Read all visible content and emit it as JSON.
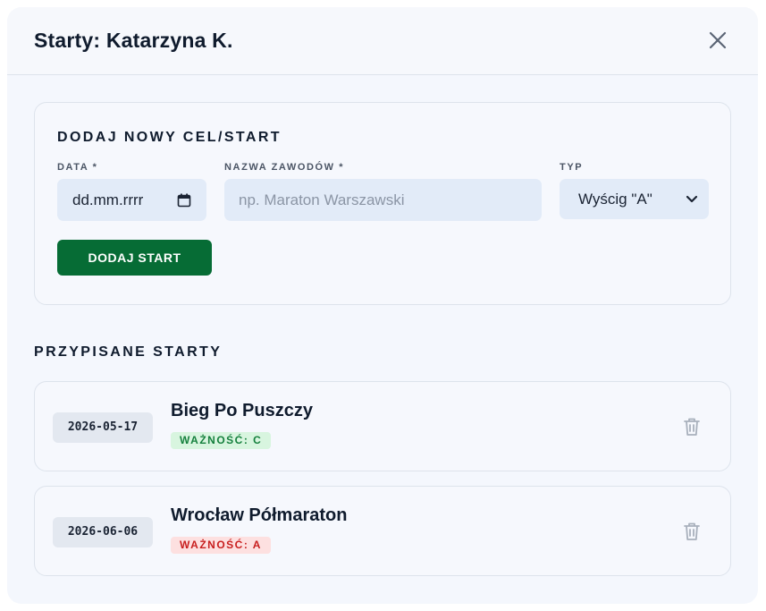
{
  "modal": {
    "title": "Starty: Katarzyna K."
  },
  "add_form": {
    "section_title": "DODAJ NOWY CEL/START",
    "date_label": "DATA *",
    "date_placeholder": "dd.mm.rrrr",
    "name_label": "NAZWA ZAWODÓW *",
    "name_placeholder": "np. Maraton Warszawski",
    "type_label": "TYP",
    "type_selected": "Wyścig \"A\"",
    "submit_label": "DODAJ START"
  },
  "assigned": {
    "section_title": "PRZYPISANE STARTY",
    "items": [
      {
        "date": "2026-05-17",
        "name": "Bieg Po Puszczy",
        "priority": "WAŻNOŚĆ: C",
        "priority_color": "#15803d"
      },
      {
        "date": "2026-06-06",
        "name": "Wrocław Półmaraton",
        "priority": "WAŻNOŚĆ: A",
        "priority_color": "#c81e1e"
      }
    ]
  },
  "colors": {
    "accent": "#066c35",
    "background": "#f4f7fd",
    "input_bg": "#e2ebf8"
  },
  "icons": {
    "close": "close-icon",
    "calendar": "calendar-icon",
    "chevron": "chevron-down-icon",
    "delete": "trash-icon"
  }
}
